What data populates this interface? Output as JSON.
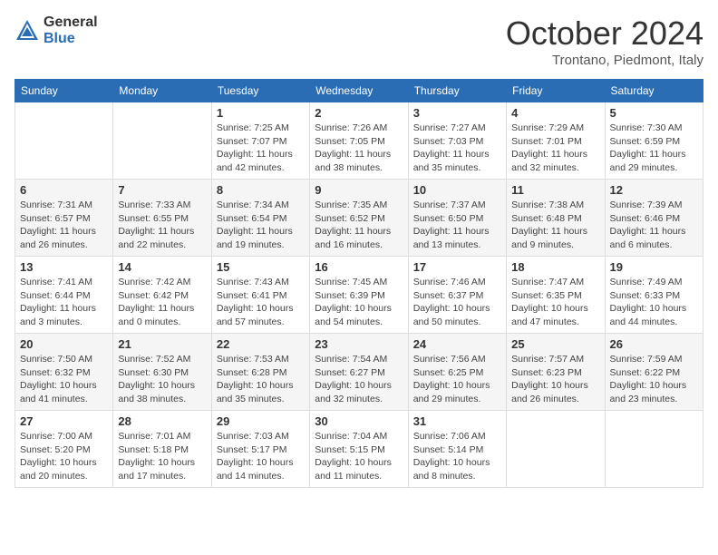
{
  "header": {
    "logo_general": "General",
    "logo_blue": "Blue",
    "month_title": "October 2024",
    "location": "Trontano, Piedmont, Italy"
  },
  "weekdays": [
    "Sunday",
    "Monday",
    "Tuesday",
    "Wednesday",
    "Thursday",
    "Friday",
    "Saturday"
  ],
  "weeks": [
    [
      {
        "day": "",
        "sunrise": "",
        "sunset": "",
        "daylight": ""
      },
      {
        "day": "",
        "sunrise": "",
        "sunset": "",
        "daylight": ""
      },
      {
        "day": "1",
        "sunrise": "Sunrise: 7:25 AM",
        "sunset": "Sunset: 7:07 PM",
        "daylight": "Daylight: 11 hours and 42 minutes."
      },
      {
        "day": "2",
        "sunrise": "Sunrise: 7:26 AM",
        "sunset": "Sunset: 7:05 PM",
        "daylight": "Daylight: 11 hours and 38 minutes."
      },
      {
        "day": "3",
        "sunrise": "Sunrise: 7:27 AM",
        "sunset": "Sunset: 7:03 PM",
        "daylight": "Daylight: 11 hours and 35 minutes."
      },
      {
        "day": "4",
        "sunrise": "Sunrise: 7:29 AM",
        "sunset": "Sunset: 7:01 PM",
        "daylight": "Daylight: 11 hours and 32 minutes."
      },
      {
        "day": "5",
        "sunrise": "Sunrise: 7:30 AM",
        "sunset": "Sunset: 6:59 PM",
        "daylight": "Daylight: 11 hours and 29 minutes."
      }
    ],
    [
      {
        "day": "6",
        "sunrise": "Sunrise: 7:31 AM",
        "sunset": "Sunset: 6:57 PM",
        "daylight": "Daylight: 11 hours and 26 minutes."
      },
      {
        "day": "7",
        "sunrise": "Sunrise: 7:33 AM",
        "sunset": "Sunset: 6:55 PM",
        "daylight": "Daylight: 11 hours and 22 minutes."
      },
      {
        "day": "8",
        "sunrise": "Sunrise: 7:34 AM",
        "sunset": "Sunset: 6:54 PM",
        "daylight": "Daylight: 11 hours and 19 minutes."
      },
      {
        "day": "9",
        "sunrise": "Sunrise: 7:35 AM",
        "sunset": "Sunset: 6:52 PM",
        "daylight": "Daylight: 11 hours and 16 minutes."
      },
      {
        "day": "10",
        "sunrise": "Sunrise: 7:37 AM",
        "sunset": "Sunset: 6:50 PM",
        "daylight": "Daylight: 11 hours and 13 minutes."
      },
      {
        "day": "11",
        "sunrise": "Sunrise: 7:38 AM",
        "sunset": "Sunset: 6:48 PM",
        "daylight": "Daylight: 11 hours and 9 minutes."
      },
      {
        "day": "12",
        "sunrise": "Sunrise: 7:39 AM",
        "sunset": "Sunset: 6:46 PM",
        "daylight": "Daylight: 11 hours and 6 minutes."
      }
    ],
    [
      {
        "day": "13",
        "sunrise": "Sunrise: 7:41 AM",
        "sunset": "Sunset: 6:44 PM",
        "daylight": "Daylight: 11 hours and 3 minutes."
      },
      {
        "day": "14",
        "sunrise": "Sunrise: 7:42 AM",
        "sunset": "Sunset: 6:42 PM",
        "daylight": "Daylight: 11 hours and 0 minutes."
      },
      {
        "day": "15",
        "sunrise": "Sunrise: 7:43 AM",
        "sunset": "Sunset: 6:41 PM",
        "daylight": "Daylight: 10 hours and 57 minutes."
      },
      {
        "day": "16",
        "sunrise": "Sunrise: 7:45 AM",
        "sunset": "Sunset: 6:39 PM",
        "daylight": "Daylight: 10 hours and 54 minutes."
      },
      {
        "day": "17",
        "sunrise": "Sunrise: 7:46 AM",
        "sunset": "Sunset: 6:37 PM",
        "daylight": "Daylight: 10 hours and 50 minutes."
      },
      {
        "day": "18",
        "sunrise": "Sunrise: 7:47 AM",
        "sunset": "Sunset: 6:35 PM",
        "daylight": "Daylight: 10 hours and 47 minutes."
      },
      {
        "day": "19",
        "sunrise": "Sunrise: 7:49 AM",
        "sunset": "Sunset: 6:33 PM",
        "daylight": "Daylight: 10 hours and 44 minutes."
      }
    ],
    [
      {
        "day": "20",
        "sunrise": "Sunrise: 7:50 AM",
        "sunset": "Sunset: 6:32 PM",
        "daylight": "Daylight: 10 hours and 41 minutes."
      },
      {
        "day": "21",
        "sunrise": "Sunrise: 7:52 AM",
        "sunset": "Sunset: 6:30 PM",
        "daylight": "Daylight: 10 hours and 38 minutes."
      },
      {
        "day": "22",
        "sunrise": "Sunrise: 7:53 AM",
        "sunset": "Sunset: 6:28 PM",
        "daylight": "Daylight: 10 hours and 35 minutes."
      },
      {
        "day": "23",
        "sunrise": "Sunrise: 7:54 AM",
        "sunset": "Sunset: 6:27 PM",
        "daylight": "Daylight: 10 hours and 32 minutes."
      },
      {
        "day": "24",
        "sunrise": "Sunrise: 7:56 AM",
        "sunset": "Sunset: 6:25 PM",
        "daylight": "Daylight: 10 hours and 29 minutes."
      },
      {
        "day": "25",
        "sunrise": "Sunrise: 7:57 AM",
        "sunset": "Sunset: 6:23 PM",
        "daylight": "Daylight: 10 hours and 26 minutes."
      },
      {
        "day": "26",
        "sunrise": "Sunrise: 7:59 AM",
        "sunset": "Sunset: 6:22 PM",
        "daylight": "Daylight: 10 hours and 23 minutes."
      }
    ],
    [
      {
        "day": "27",
        "sunrise": "Sunrise: 7:00 AM",
        "sunset": "Sunset: 5:20 PM",
        "daylight": "Daylight: 10 hours and 20 minutes."
      },
      {
        "day": "28",
        "sunrise": "Sunrise: 7:01 AM",
        "sunset": "Sunset: 5:18 PM",
        "daylight": "Daylight: 10 hours and 17 minutes."
      },
      {
        "day": "29",
        "sunrise": "Sunrise: 7:03 AM",
        "sunset": "Sunset: 5:17 PM",
        "daylight": "Daylight: 10 hours and 14 minutes."
      },
      {
        "day": "30",
        "sunrise": "Sunrise: 7:04 AM",
        "sunset": "Sunset: 5:15 PM",
        "daylight": "Daylight: 10 hours and 11 minutes."
      },
      {
        "day": "31",
        "sunrise": "Sunrise: 7:06 AM",
        "sunset": "Sunset: 5:14 PM",
        "daylight": "Daylight: 10 hours and 8 minutes."
      },
      {
        "day": "",
        "sunrise": "",
        "sunset": "",
        "daylight": ""
      },
      {
        "day": "",
        "sunrise": "",
        "sunset": "",
        "daylight": ""
      }
    ]
  ]
}
